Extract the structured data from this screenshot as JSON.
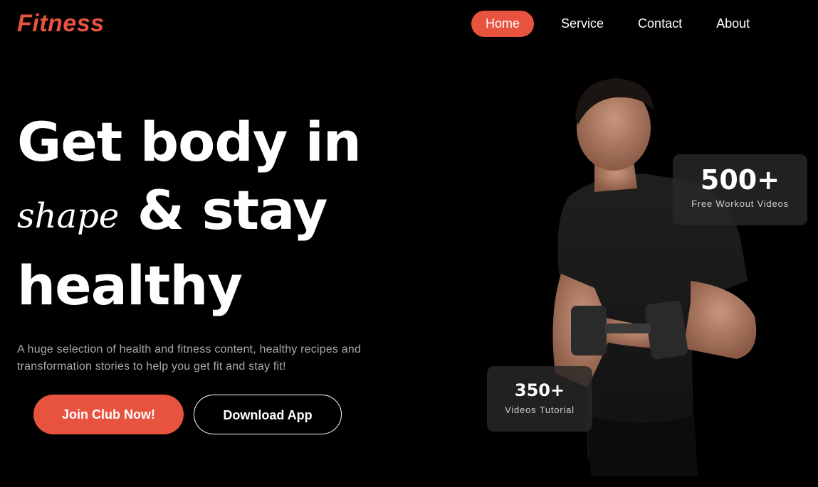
{
  "brand": {
    "logo": "Fitness",
    "accent_color": "#e8533f"
  },
  "nav": {
    "items": [
      {
        "label": "Home",
        "active": true
      },
      {
        "label": "Service",
        "active": false
      },
      {
        "label": "Contact",
        "active": false
      },
      {
        "label": "About",
        "active": false
      }
    ]
  },
  "hero": {
    "title_line1": "Get body in",
    "title_script": "shape",
    "title_line2_rest": "& stay",
    "title_line3": "healthy",
    "subtitle": "A huge selection of health and fitness content, healthy recipes and transformation stories to help you get fit and stay fit!",
    "primary_button": "Join Club Now!",
    "secondary_button": "Download App"
  },
  "stats": [
    {
      "value": "500+",
      "label": "Free Workout Videos"
    },
    {
      "value": "350+",
      "label": "Videos Tutorial"
    }
  ],
  "image": {
    "subject": "man in black t-shirt holding dumbbell"
  }
}
